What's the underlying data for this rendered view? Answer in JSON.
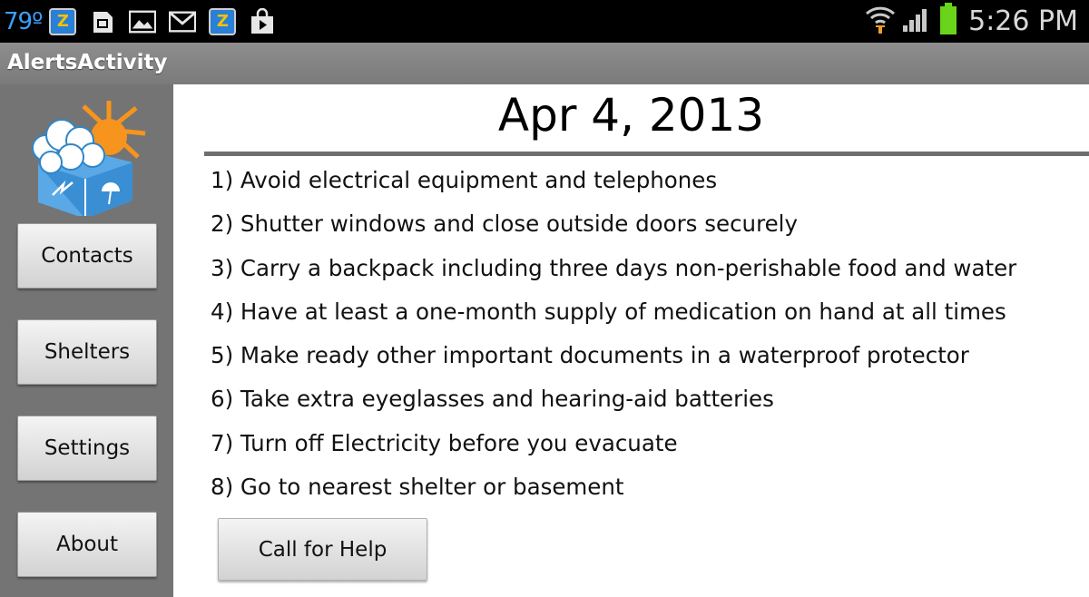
{
  "status_bar": {
    "temperature": "79º",
    "time": "5:26 PM",
    "left_icons": [
      "z-app-icon",
      "sd-card-icon",
      "image-icon",
      "gmail-icon",
      "z-app-icon",
      "shopping-bag-icon"
    ],
    "right_icons": [
      "wifi-icon",
      "signal-icon",
      "battery-icon"
    ],
    "z_letter": "Z"
  },
  "title_bar": {
    "title": "AlertsActivity"
  },
  "sidebar": {
    "logo": "weather-box-logo",
    "buttons": [
      {
        "label": "Contacts"
      },
      {
        "label": "Shelters"
      },
      {
        "label": "Settings"
      },
      {
        "label": "About"
      }
    ]
  },
  "main": {
    "date": "Apr 4, 2013",
    "tips": [
      "1) Avoid electrical equipment and telephones",
      "2) Shutter windows and close outside doors securely",
      "3) Carry a backpack including three days non-perishable food and water",
      "4) Have at least a one-month supply of medication on hand at all times",
      "5) Make ready other important documents in a waterproof protector",
      "6) Take extra eyeglasses and hearing-aid batteries",
      "7) Turn off Electricity before you evacuate",
      "8) Go to nearest shelter or basement"
    ],
    "call_button": "Call for Help"
  },
  "colors": {
    "status_bar": "#000000",
    "title_bar": "#858585",
    "sidebar": "#747474",
    "temperature": "#3aa0ff",
    "battery": "#6ad41a"
  }
}
